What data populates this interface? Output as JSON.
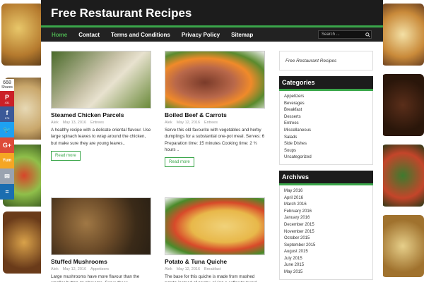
{
  "site": {
    "title": "Free Restaurant Recipes"
  },
  "nav": {
    "items": [
      "Home",
      "Contact",
      "Terms and Conditions",
      "Privacy Policy",
      "Sitemap"
    ],
    "search_placeholder": "Search ..."
  },
  "share": {
    "count": "668",
    "label": "Shares",
    "pinterest": "431",
    "facebook": "176"
  },
  "posts": [
    {
      "title": "Steamed Chicken Parcels",
      "author": "Alek",
      "date": "May 13, 2016",
      "category": "Entrees",
      "excerpt": "A healthy recipe with a delicate oriental flavour. Use large spinach leaves to wrap around the chicken, but make sure they are young leaves..",
      "readmore": "Read more"
    },
    {
      "title": "Boiled Beef & Carrots",
      "author": "Alek",
      "date": "May 12, 2016",
      "category": "Entrees",
      "excerpt": "Serve this old favourite with vegetables and herby dumplings for a substantial one-pot meal. Serves: 6 Preparation time: 15 minutes Cooking time: 2 ¾ hours ..",
      "readmore": "Read more"
    },
    {
      "title": "Stuffed Mushrooms",
      "author": "Alek",
      "date": "May 12, 2016",
      "category": "Appetizers",
      "excerpt": "Large mushrooms have more flavour than the smaller button mushrooms. Serve these mushrooms"
    },
    {
      "title": "Potato & Tuna Quiche",
      "author": "Alek",
      "date": "May 12, 2016",
      "category": "Breakfast",
      "excerpt": "The base for this quiche is made from mashed potato instead of pastry, giving a softer textured"
    }
  ],
  "sidebar": {
    "tagline": "Free Restaurant Recipes",
    "categories_title": "Categories",
    "categories": [
      "Appetizers",
      "Beverages",
      "Breakfast",
      "Desserts",
      "Entrees",
      "Miscellaneous",
      "Salads",
      "Side Dishes",
      "Soups",
      "Uncategorized"
    ],
    "archives_title": "Archives",
    "archives": [
      "May 2016",
      "April 2016",
      "March 2016",
      "February 2016",
      "January 2016",
      "December 2015",
      "November 2015",
      "October 2015",
      "September 2015",
      "August 2015",
      "July 2015",
      "June 2015",
      "May 2015"
    ]
  }
}
